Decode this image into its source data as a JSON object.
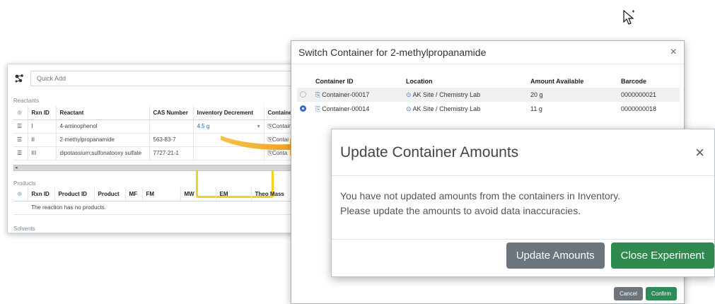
{
  "grid": {
    "quick_add_placeholder": "Quick Add",
    "reactants_label": "Reactants",
    "reactant_headers": [
      "Rxn ID",
      "Reactant",
      "CAS Number",
      "Inventory Decrement",
      "Containe"
    ],
    "reactants": [
      {
        "rxn_id": "I",
        "name": "4-aminophenol",
        "cas": "",
        "decrement": "4.5 g",
        "container": "Contain"
      },
      {
        "rxn_id": "II",
        "name": "2-methylpropanamide",
        "cas": "563-83-7",
        "decrement": "",
        "container": "Contai"
      },
      {
        "rxn_id": "III",
        "name": "dipotassium;sulfonatooxy sulfate",
        "cas": "7727-21-1",
        "decrement": "",
        "container": "Conta"
      }
    ],
    "products_label": "Products",
    "product_headers": [
      "Rxn ID",
      "Product ID",
      "Product",
      "MF",
      "FM",
      "MW",
      "EM",
      "Theo Mass"
    ],
    "no_products_text": "The reaction has no products.",
    "solvents_label": "Solvents"
  },
  "switch_modal": {
    "title": "Switch Container for 2-methylpropanamide",
    "close_symbol": "×",
    "headers": [
      "Container ID",
      "Location",
      "Amount Available",
      "Barcode"
    ],
    "rows": [
      {
        "id": "Container-00017",
        "location": "AK Site / Chemistry Lab",
        "amount": "20 g",
        "barcode": "0000000021",
        "selected": false
      },
      {
        "id": "Container-00014",
        "location": "AK Site / Chemistry Lab",
        "amount": "11 g",
        "barcode": "0000000018",
        "selected": true
      }
    ],
    "cancel_label": "Cancel",
    "confirm_label": "Confirm"
  },
  "update_modal": {
    "title": "Update Container Amounts",
    "close_symbol": "×",
    "body_line1": "You have not updated amounts from the containers in Inventory.",
    "body_line2": "Please update the amounts to avoid data inaccuracies.",
    "update_label": "Update Amounts",
    "close_label": "Close Experiment"
  },
  "colors": {
    "highlight": "#f3d21f",
    "arrow": "#f0a22a",
    "link": "#2b6cb8",
    "success": "#2f8a4f",
    "secondary": "#6c757d"
  }
}
